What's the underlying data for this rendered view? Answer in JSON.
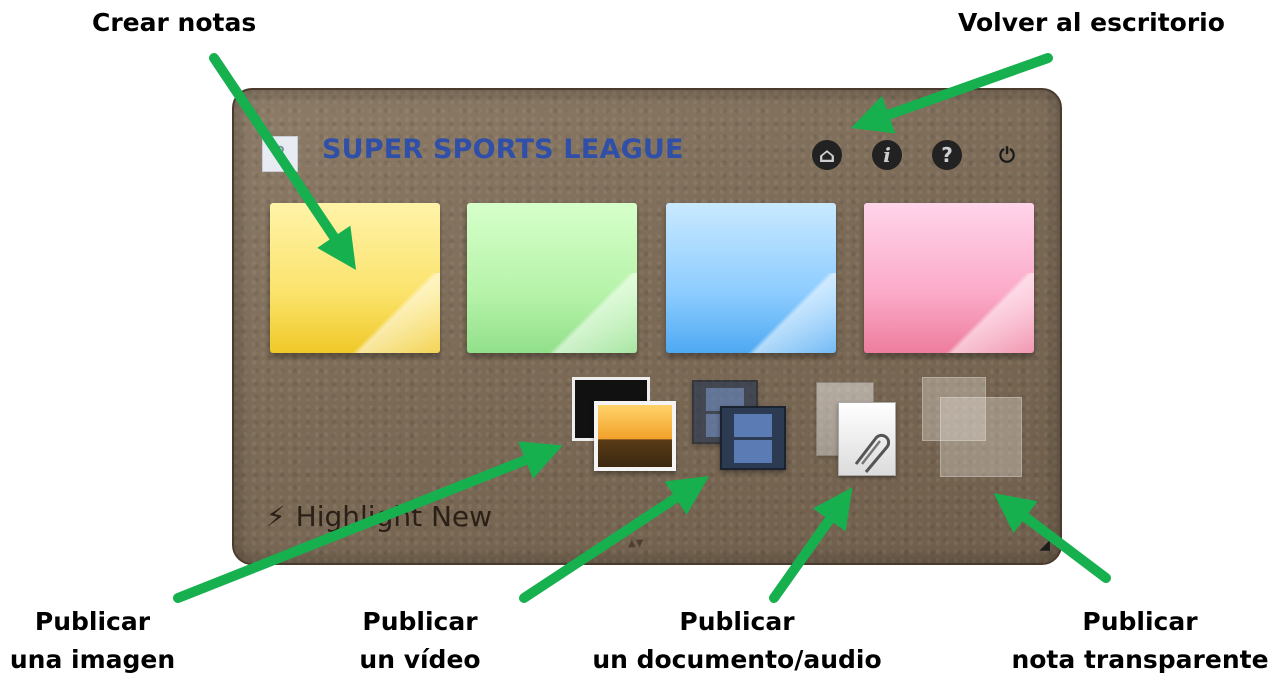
{
  "callouts": {
    "crear_notas": "Crear notas",
    "volver": "Volver al escritorio",
    "imagen": [
      "Publicar",
      "una imagen"
    ],
    "video": [
      "Publicar",
      "un vídeo"
    ],
    "documento": [
      "Publicar",
      "un documento/audio"
    ],
    "transparente": [
      "Publicar",
      "nota transparente"
    ]
  },
  "board": {
    "title": "SUPER SPORTS LEAGUE",
    "logo_glyph": "?",
    "toolbar": [
      {
        "name": "home-icon",
        "glyph": "⌂"
      },
      {
        "name": "info-icon",
        "glyph": "i"
      },
      {
        "name": "help-icon",
        "glyph": "?"
      },
      {
        "name": "power-icon",
        "glyph": "⏻"
      }
    ],
    "notes": [
      {
        "name": "yellow-note",
        "color": "#f9e06a"
      },
      {
        "name": "green-note",
        "color": "#b6f3a9"
      },
      {
        "name": "blue-note",
        "color": "#8dccff"
      },
      {
        "name": "pink-note",
        "color": "#fbaac8"
      }
    ],
    "highlight_label": "Highlight New",
    "bolt_glyph": "⚡",
    "sort_glyph": "▲▼",
    "corner_glyph": "◢"
  },
  "arrow_color": "#16b04f"
}
